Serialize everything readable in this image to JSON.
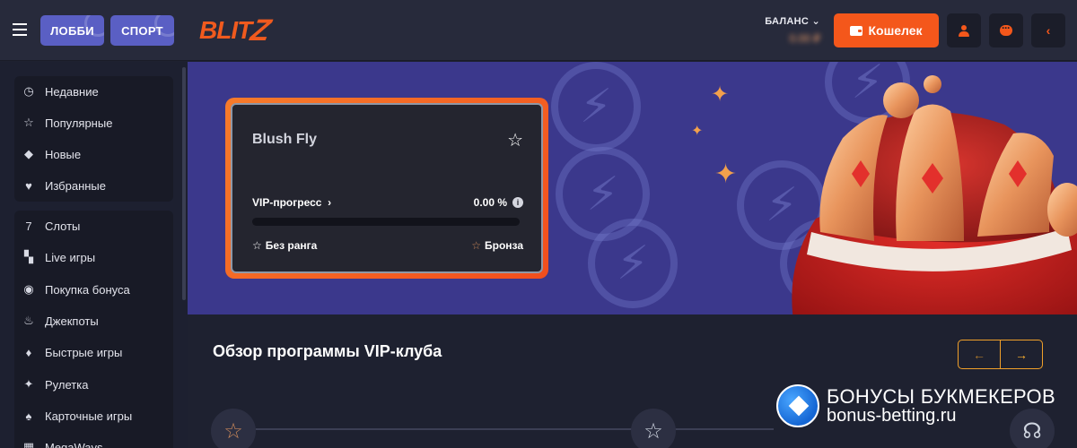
{
  "header": {
    "lobby_label": "ЛОББИ",
    "sport_label": "СПОРТ",
    "logo_text": "BLITZ",
    "balance_label": "БАЛАНС",
    "balance_value": "0.00 ₽",
    "wallet_label": "Кошелек"
  },
  "sidebar": {
    "group1": [
      {
        "label": "Недавние",
        "icon": "clock-icon"
      },
      {
        "label": "Популярные",
        "icon": "star-icon"
      },
      {
        "label": "Новые",
        "icon": "diamond-icon"
      },
      {
        "label": "Избранные",
        "icon": "heart-icon"
      }
    ],
    "group2": [
      {
        "label": "Слоты",
        "icon": "slots-icon"
      },
      {
        "label": "Live игры",
        "icon": "live-icon"
      },
      {
        "label": "Покупка бонуса",
        "icon": "bonus-icon"
      },
      {
        "label": "Джекпоты",
        "icon": "fire-icon"
      },
      {
        "label": "Быстрые игры",
        "icon": "flame-icon"
      },
      {
        "label": "Рулетка",
        "icon": "roulette-icon"
      },
      {
        "label": "Карточные игры",
        "icon": "cards-icon"
      },
      {
        "label": "MegaWays",
        "icon": "megaways-icon"
      }
    ]
  },
  "vip_card": {
    "name": "Blush Fly",
    "progress_label": "VIP-прогресс",
    "progress_percent": "0.00 %",
    "progress_value": 0,
    "rank_current": "Без ранга",
    "rank_next": "Бронза"
  },
  "main": {
    "section_title": "Обзор программы VIP-клуба",
    "prev_arrow": "←",
    "next_arrow": "→"
  },
  "watermark": {
    "line1": "БОНУСЫ БУКМЕКЕРОВ",
    "line2": "bonus-betting.ru"
  },
  "colors": {
    "accent": "#f4571b",
    "banner_bg": "#3b388c",
    "nav_button": "#5a5fc4",
    "arrow_border": "#f0a02a"
  }
}
